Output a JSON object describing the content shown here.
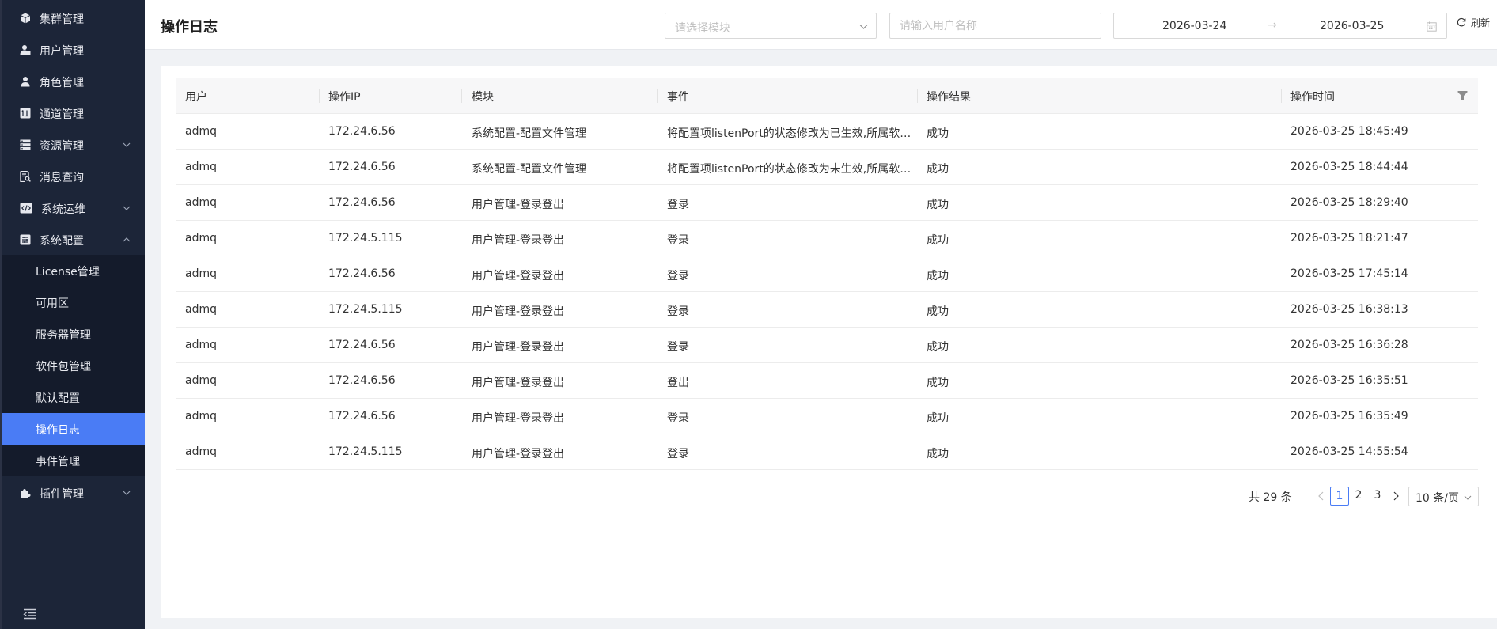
{
  "sidebar": {
    "items": [
      {
        "label": "集群管理",
        "icon": "cube-icon"
      },
      {
        "label": "用户管理",
        "icon": "user-icon"
      },
      {
        "label": "角色管理",
        "icon": "role-icon"
      },
      {
        "label": "通道管理",
        "icon": "channel-icon"
      },
      {
        "label": "资源管理",
        "icon": "server-icon"
      },
      {
        "label": "消息查询",
        "icon": "message-search-icon"
      },
      {
        "label": "系统运维",
        "icon": "code-icon"
      },
      {
        "label": "系统配置",
        "icon": "config-icon"
      },
      {
        "label": "插件管理",
        "icon": "plugin-icon"
      }
    ],
    "submenu": [
      {
        "label": "License管理"
      },
      {
        "label": "可用区"
      },
      {
        "label": "服务器管理"
      },
      {
        "label": "软件包管理"
      },
      {
        "label": "默认配置"
      },
      {
        "label": "操作日志"
      },
      {
        "label": "事件管理"
      }
    ],
    "active_submenu": "操作日志"
  },
  "header": {
    "title": "操作日志",
    "module_select_placeholder": "请选择模块",
    "username_placeholder": "请输入用户名称",
    "date_start": "2026-03-24",
    "date_arrow": "→",
    "date_end": "2026-03-25",
    "refresh_label": "刷新"
  },
  "table": {
    "columns": [
      "用户",
      "操作IP",
      "模块",
      "事件",
      "操作结果",
      "操作时间"
    ],
    "rows": [
      {
        "user": "admq",
        "ip": "172.24.6.56",
        "module": "系统配置-配置文件管理",
        "event": "将配置项listenPort的状态修改为已生效,所属软…",
        "result": "成功",
        "time": "2026-03-25 18:45:49"
      },
      {
        "user": "admq",
        "ip": "172.24.6.56",
        "module": "系统配置-配置文件管理",
        "event": "将配置项listenPort的状态修改为未生效,所属软…",
        "result": "成功",
        "time": "2026-03-25 18:44:44"
      },
      {
        "user": "admq",
        "ip": "172.24.6.56",
        "module": "用户管理-登录登出",
        "event": "登录",
        "result": "成功",
        "time": "2026-03-25 18:29:40"
      },
      {
        "user": "admq",
        "ip": "172.24.5.115",
        "module": "用户管理-登录登出",
        "event": "登录",
        "result": "成功",
        "time": "2026-03-25 18:21:47"
      },
      {
        "user": "admq",
        "ip": "172.24.6.56",
        "module": "用户管理-登录登出",
        "event": "登录",
        "result": "成功",
        "time": "2026-03-25 17:45:14"
      },
      {
        "user": "admq",
        "ip": "172.24.5.115",
        "module": "用户管理-登录登出",
        "event": "登录",
        "result": "成功",
        "time": "2026-03-25 16:38:13"
      },
      {
        "user": "admq",
        "ip": "172.24.6.56",
        "module": "用户管理-登录登出",
        "event": "登录",
        "result": "成功",
        "time": "2026-03-25 16:36:28"
      },
      {
        "user": "admq",
        "ip": "172.24.6.56",
        "module": "用户管理-登录登出",
        "event": "登出",
        "result": "成功",
        "time": "2026-03-25 16:35:51"
      },
      {
        "user": "admq",
        "ip": "172.24.6.56",
        "module": "用户管理-登录登出",
        "event": "登录",
        "result": "成功",
        "time": "2026-03-25 16:35:49"
      },
      {
        "user": "admq",
        "ip": "172.24.5.115",
        "module": "用户管理-登录登出",
        "event": "登录",
        "result": "成功",
        "time": "2026-03-25 14:55:54"
      }
    ]
  },
  "pagination": {
    "total_text": "共 29 条",
    "pages": [
      "1",
      "2",
      "3"
    ],
    "current_page": "1",
    "page_size": "10 条/页"
  },
  "colors": {
    "sidebar_bg": "#1c2538",
    "active": "#4a7cf5"
  }
}
